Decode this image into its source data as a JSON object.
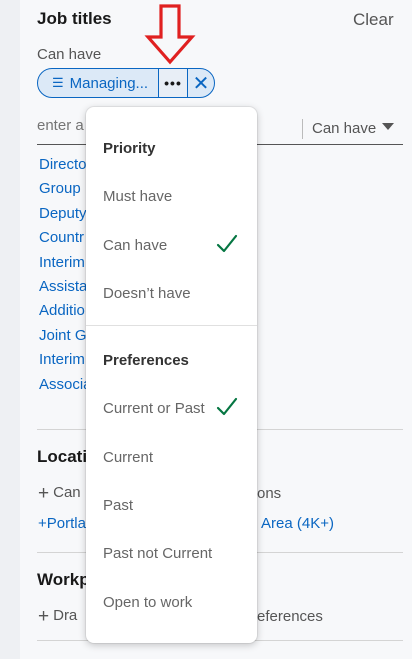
{
  "job_titles": {
    "title": "Job titles",
    "clear_label": "Clear",
    "can_have_label": "Can have",
    "chip": {
      "label": "Managing...",
      "more_label": "•••",
      "remove_label": "✕"
    },
    "input": {
      "placeholder": "enter a"
    },
    "select": {
      "value": "Can have"
    },
    "suggestions": [
      "Directo",
      "Group",
      "Deputy",
      "Countr",
      "Interim",
      "Assista",
      "Additio",
      "Joint G",
      "Interim",
      "Associa"
    ]
  },
  "location": {
    "title": "Locati",
    "add_left": "Can",
    "add_right": "ons",
    "link_left": "+Portla",
    "link_right": "Area (4K+)"
  },
  "workplace": {
    "title": "Workp",
    "add_left": "Dra",
    "add_right": "eferences"
  },
  "dropdown": {
    "priority_heading": "Priority",
    "priority_items": [
      {
        "label": "Must have",
        "checked": false
      },
      {
        "label": "Can have",
        "checked": true
      },
      {
        "label": "Doesn’t have",
        "checked": false
      }
    ],
    "preferences_heading": "Preferences",
    "preferences_items": [
      {
        "label": "Current or Past",
        "checked": true
      },
      {
        "label": "Current",
        "checked": false
      },
      {
        "label": "Past",
        "checked": false
      },
      {
        "label": "Past not Current",
        "checked": false
      },
      {
        "label": "Open to work",
        "checked": false
      }
    ]
  },
  "colors": {
    "accent": "#0a66c2",
    "check": "#057642",
    "annotation_arrow": "#e02020"
  }
}
